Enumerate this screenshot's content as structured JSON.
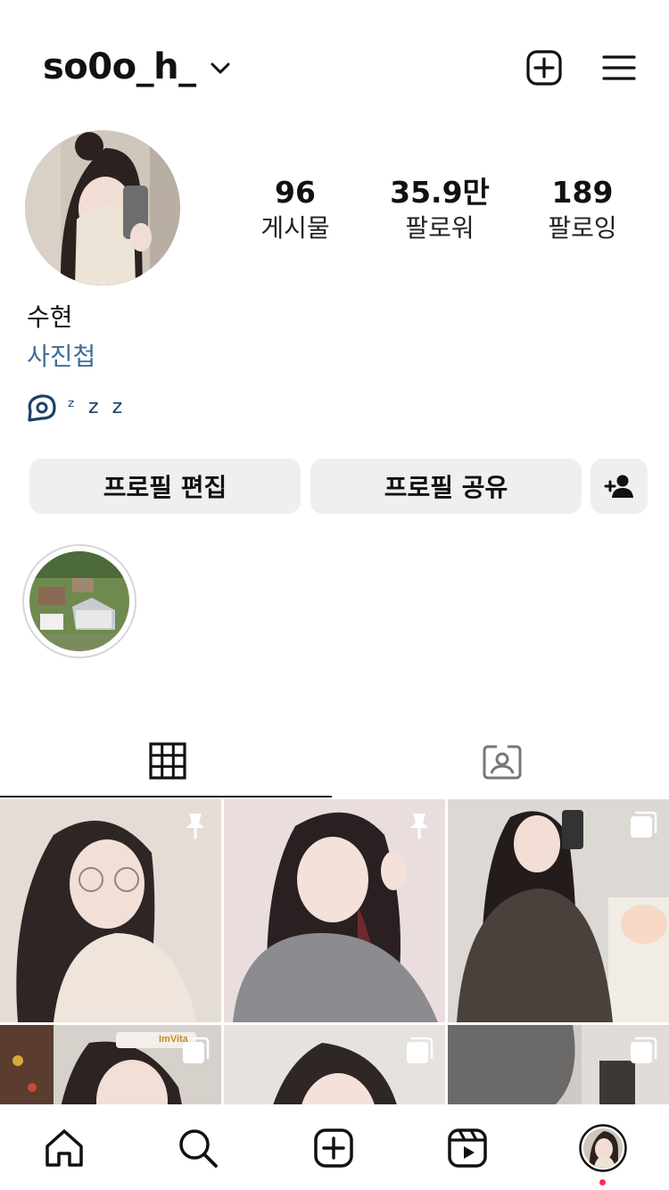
{
  "header": {
    "username": "so0o_h_",
    "icons": [
      "chevron-down-icon",
      "new-post-icon",
      "menu-icon"
    ]
  },
  "profile": {
    "stats": [
      {
        "value": "96",
        "label": "게시물"
      },
      {
        "value": "35.9만",
        "label": "팔로워"
      },
      {
        "value": "189",
        "label": "팔로잉"
      }
    ],
    "display_name": "수현",
    "category": "사진첩",
    "threads_text": "ᶻ z 𝗓"
  },
  "buttons": {
    "edit_profile": "프로필 편집",
    "share_profile": "프로필 공유",
    "discover_icon": "add-person-icon"
  },
  "tabs": [
    {
      "icon": "grid-icon",
      "active": true
    },
    {
      "icon": "tagged-icon",
      "active": false
    }
  ],
  "grid": {
    "tiles": [
      {
        "badge": "pin-icon"
      },
      {
        "badge": "pin-icon"
      },
      {
        "badge": "multi-post-icon"
      },
      {
        "badge": "multi-post-icon",
        "sticker": "ImVita"
      },
      {
        "badge": "multi-post-icon"
      },
      {
        "badge": "multi-post-icon"
      }
    ]
  },
  "nav": {
    "items": [
      "home-icon",
      "search-icon",
      "create-icon",
      "reels-icon",
      "profile-avatar"
    ],
    "notification_color": "#ff2d55"
  },
  "colors": {
    "link": "#3f6f97",
    "button_bg": "#efefef",
    "text": "#111111"
  }
}
